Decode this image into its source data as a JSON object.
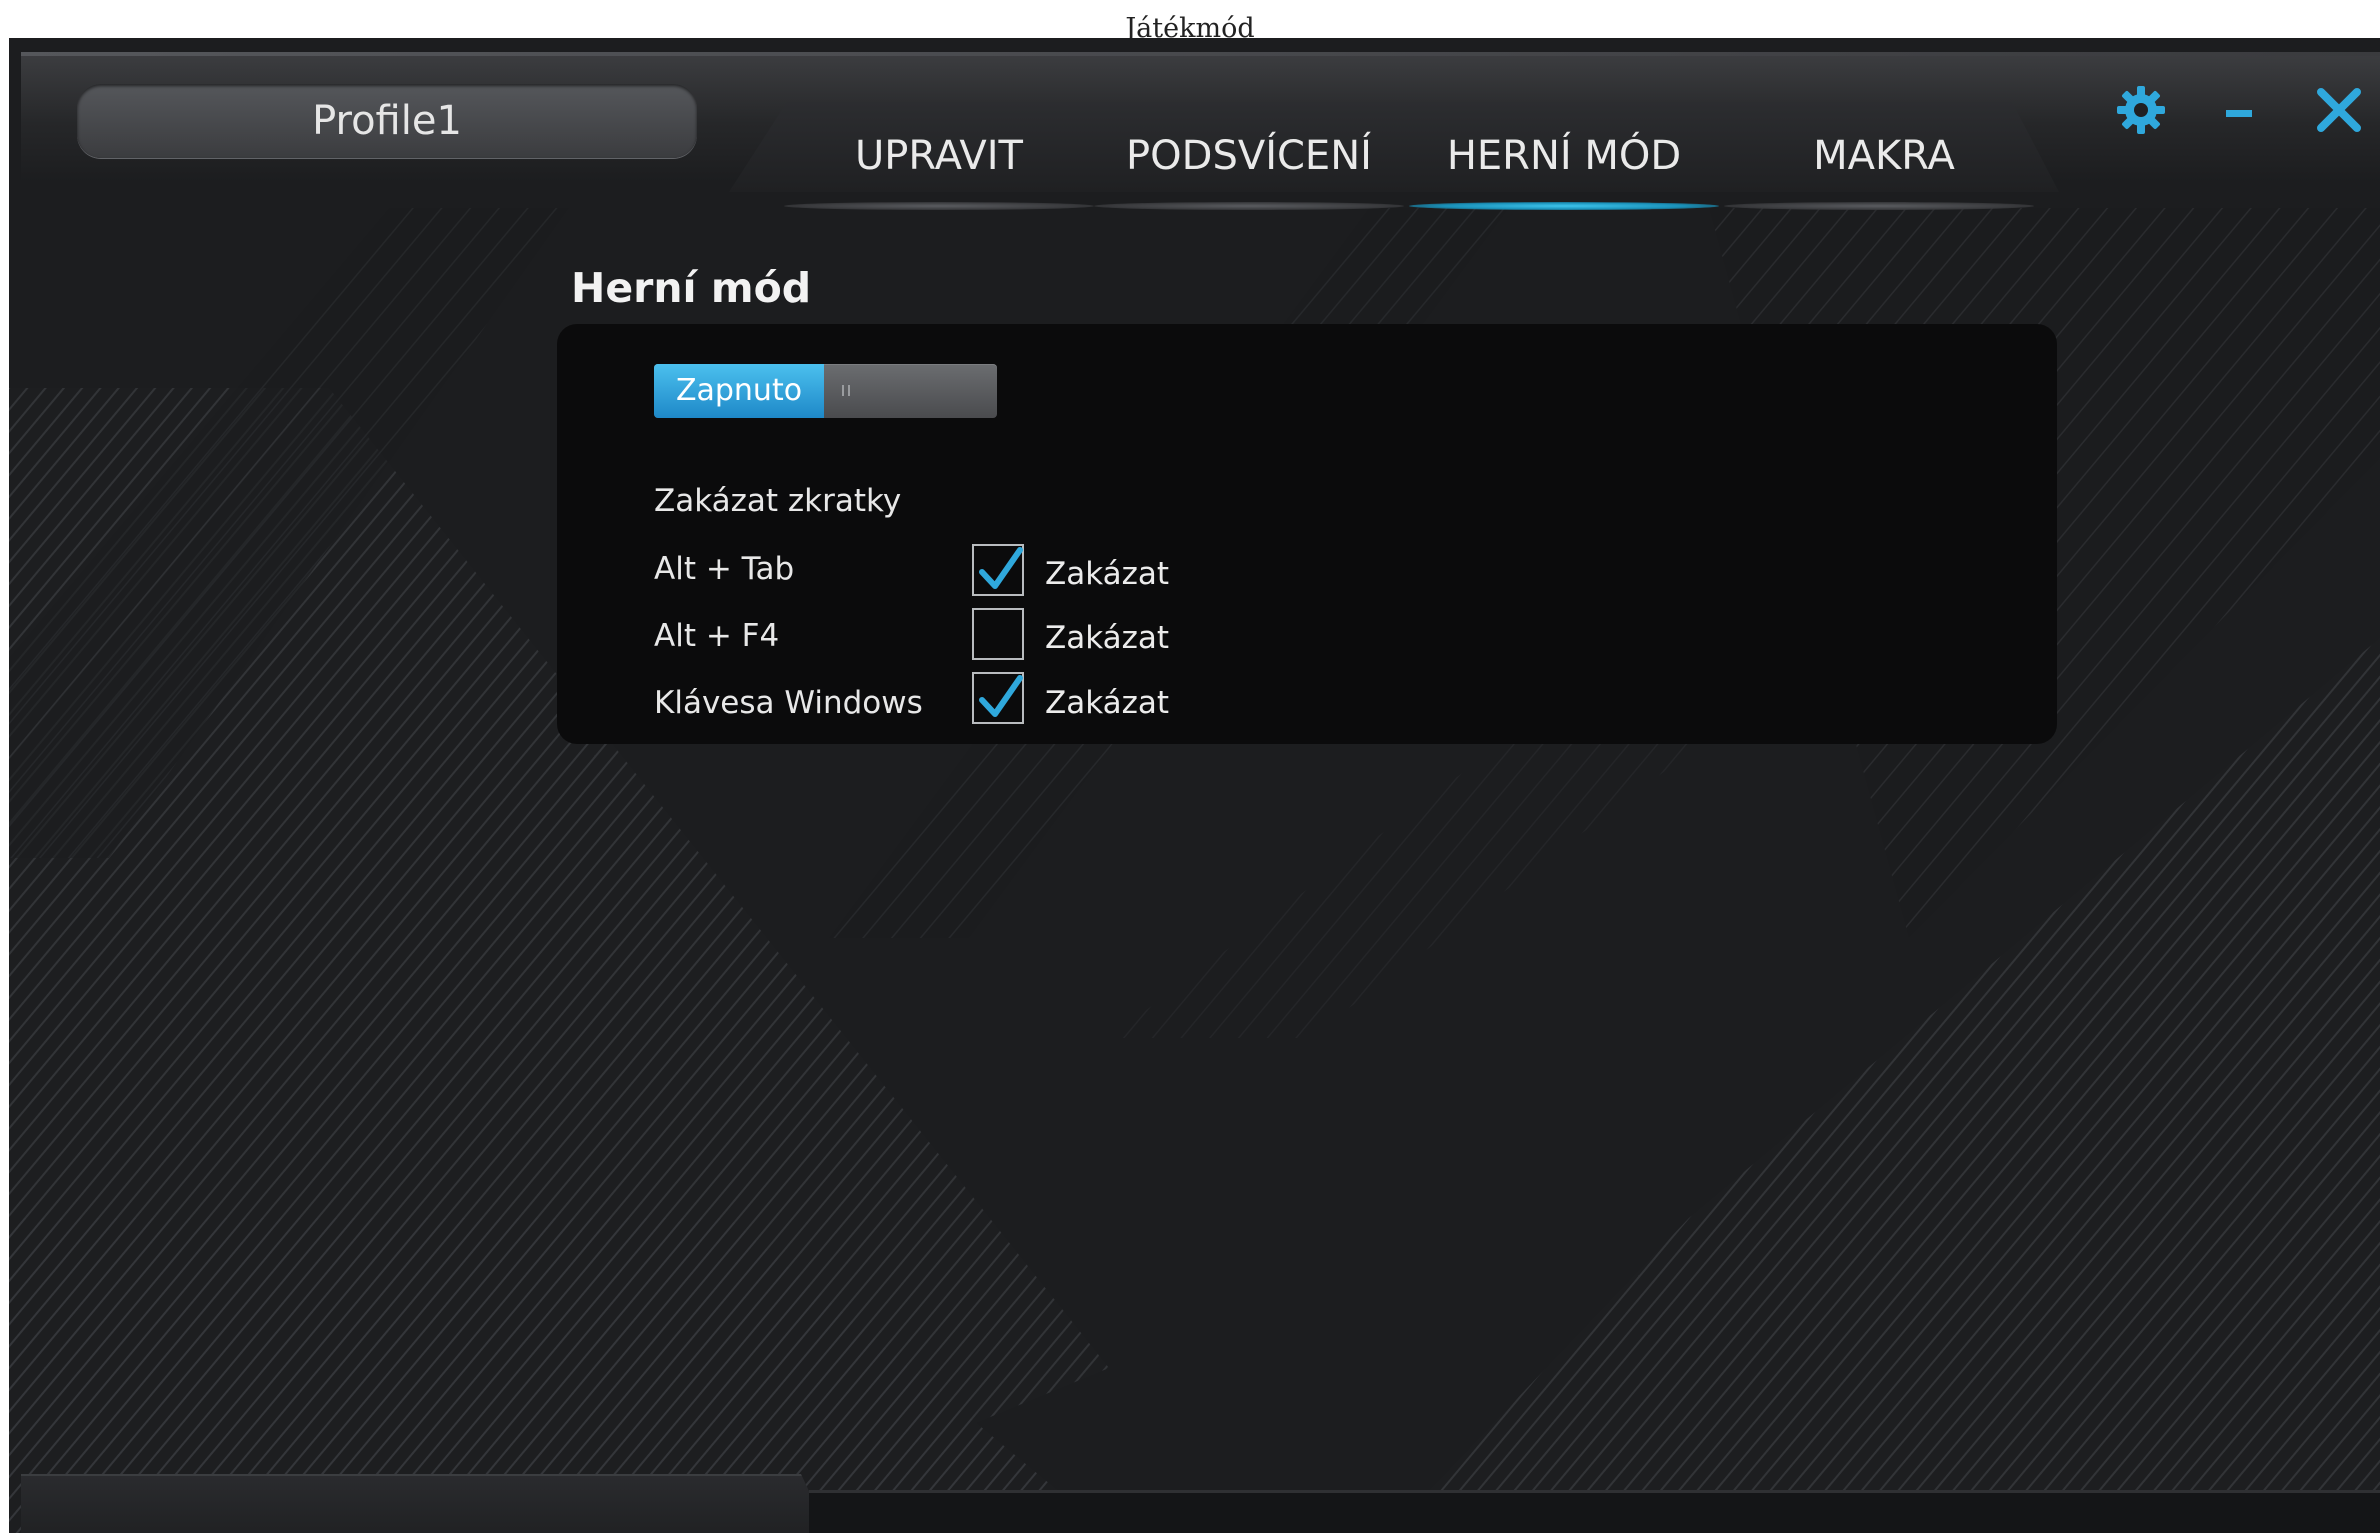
{
  "caption": "Játékmód",
  "header": {
    "profile_name": "Profile1",
    "tabs": [
      {
        "label": "UPRAVIT",
        "active": false
      },
      {
        "label": "PODSVÍCENÍ",
        "active": false
      },
      {
        "label": "HERNÍ MÓD",
        "active": true
      },
      {
        "label": "MAKRA",
        "active": false
      }
    ],
    "controls": {
      "settings_icon": "gear-icon",
      "minimize_icon": "minimize-icon",
      "close_icon": "close-icon"
    }
  },
  "game_mode": {
    "title": "Herní mód",
    "toggle": {
      "label": "Zapnuto",
      "state": "on"
    },
    "shortcuts_heading": "Zakázat zkratky",
    "shortcuts": [
      {
        "key": "Alt + Tab",
        "option_label": "Zakázat",
        "checked": true
      },
      {
        "key": "Alt + F4",
        "option_label": "Zakázat",
        "checked": false
      },
      {
        "key": "Klávesa Windows",
        "option_label": "Zakázat",
        "checked": true
      }
    ]
  },
  "colors": {
    "accent": "#2fa8dc",
    "background": "#1d1e20",
    "panel": "#0b0b0c",
    "text": "#e8e8e8"
  }
}
